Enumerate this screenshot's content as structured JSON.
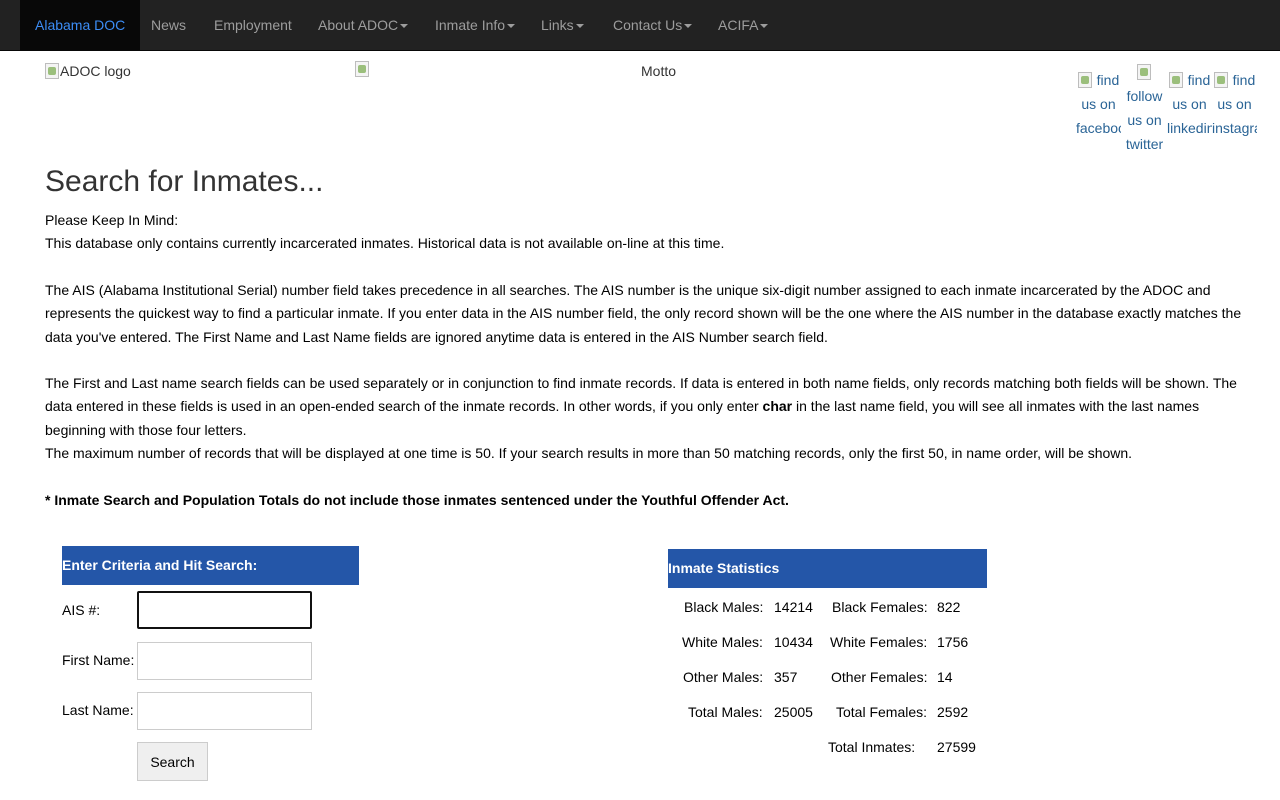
{
  "nav": {
    "brand": "Alabama DOC",
    "items": [
      {
        "label": "News"
      },
      {
        "label": "Employment"
      },
      {
        "label": "About ADOC"
      },
      {
        "label": "Inmate Info"
      },
      {
        "label": "Links"
      },
      {
        "label": "Contact Us"
      },
      {
        "label": "ACIFA"
      }
    ]
  },
  "header": {
    "logo_alt": "ADOC logo",
    "motto_alt": "Motto",
    "social": [
      {
        "alt": "find us on facebook"
      },
      {
        "alt": "follow us on twitter"
      },
      {
        "alt": "find us on linkedin"
      },
      {
        "alt": "find us on instagram"
      }
    ]
  },
  "main": {
    "title": "Search for Inmates...",
    "keep_in_mind": "Please Keep In Mind:",
    "para1": "This database only contains currently incarcerated inmates. Historical data is not available on-line at this time.",
    "para2": "The AIS (Alabama Institutional Serial) number field takes precedence in all searches. The AIS number is the unique six-digit number assigned to each inmate incarcerated by the ADOC and represents the quickest way to find a particular inmate. If you enter data in the AIS number field, the only record shown will be the one where the AIS number in the database exactly matches the data you've entered. The First Name and Last Name fields are ignored anytime data is entered in the AIS Number search field.",
    "para3_before": "The First and Last name search fields can be used separately or in conjunction to find inmate records. If data is entered in both name fields, only records matching both fields will be shown. The data entered in these fields is used in an open-ended search of the inmate records. In other words, if you only enter ",
    "para3_bold": "char",
    "para3_after": " in the last name field, you will see all inmates with the last names beginning with those four letters.",
    "para4": "The maximum number of records that will be displayed at one time is 50. If your search results in more than 50 matching records, only the first 50, in name order, will be shown.",
    "note": "* Inmate Search and Population Totals do not include those inmates sentenced under the Youthful Offender Act."
  },
  "search_form": {
    "header": "Enter Criteria and Hit Search:",
    "ais_label": "AIS #:",
    "ais_value": "",
    "first_label": "First Name:",
    "first_value": "",
    "last_label": "Last Name:",
    "last_value": "",
    "button": "Search"
  },
  "stats": {
    "header": "Inmate Statistics",
    "black_males_label": "Black Males:",
    "black_males": "14214",
    "black_females_label": "Black Females:",
    "black_females": "822",
    "white_males_label": "White Males:",
    "white_males": "10434",
    "white_females_label": "White Females:",
    "white_females": "1756",
    "other_males_label": "Other Males:",
    "other_males": "357",
    "other_females_label": "Other Females:",
    "other_females": "14",
    "total_males_label": "Total Males:",
    "total_males": "25005",
    "total_females_label": "Total Females:",
    "total_females": "2592",
    "total_inmates_label": "Total Inmates:",
    "total_inmates": "27599"
  },
  "colors": {
    "navbar_bg": "#222222",
    "brand_link": "#3c8df6",
    "panel_header": "#2456a8"
  }
}
